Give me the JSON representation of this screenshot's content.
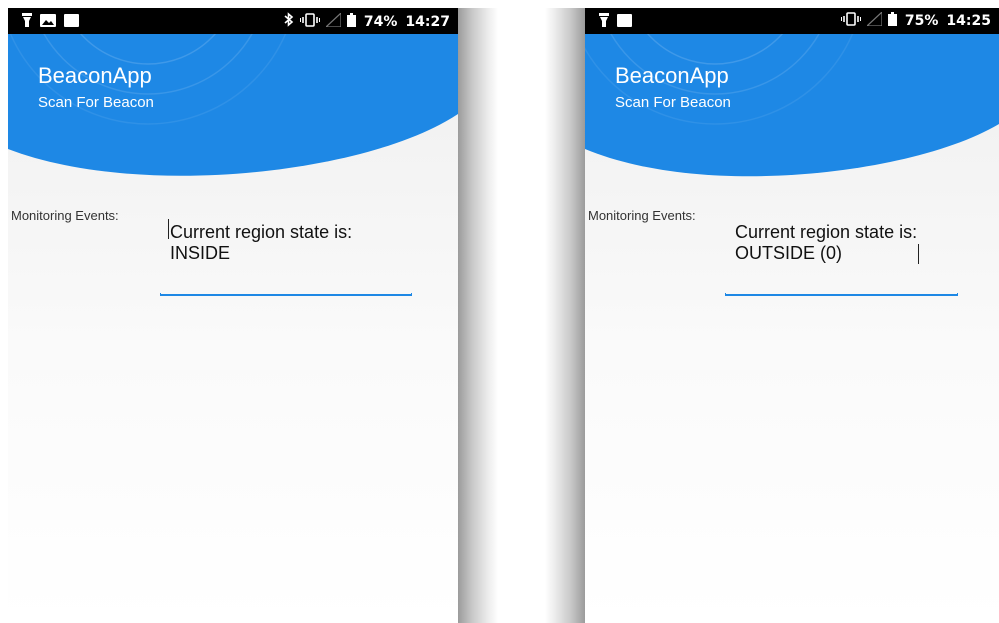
{
  "theme": {
    "header_color": "#1e88e5",
    "accent": "#1e88e5"
  },
  "left_screen": {
    "status_bar": {
      "left_icons": [
        "flashlight-icon",
        "image-icon",
        "square-icon"
      ],
      "right_icons": [
        "bluetooth-icon",
        "vibrate-icon",
        "signal-icon",
        "battery-icon"
      ],
      "battery_percent": "74%",
      "time": "14:27"
    },
    "app_title": "BeaconApp",
    "app_subtitle": "Scan For Beacon",
    "monitoring_label": "Monitoring Events:",
    "region_state_text": "Current region state is:\nINSIDE"
  },
  "right_screen": {
    "status_bar": {
      "left_icons": [
        "flashlight-icon",
        "square-icon"
      ],
      "right_icons": [
        "vibrate-icon",
        "signal-icon",
        "battery-icon"
      ],
      "battery_percent": "75%",
      "time": "14:25"
    },
    "app_title": "BeaconApp",
    "app_subtitle": "Scan For Beacon",
    "monitoring_label": "Monitoring Events:",
    "region_state_text": "Current region state is:\nOUTSIDE (0)"
  }
}
